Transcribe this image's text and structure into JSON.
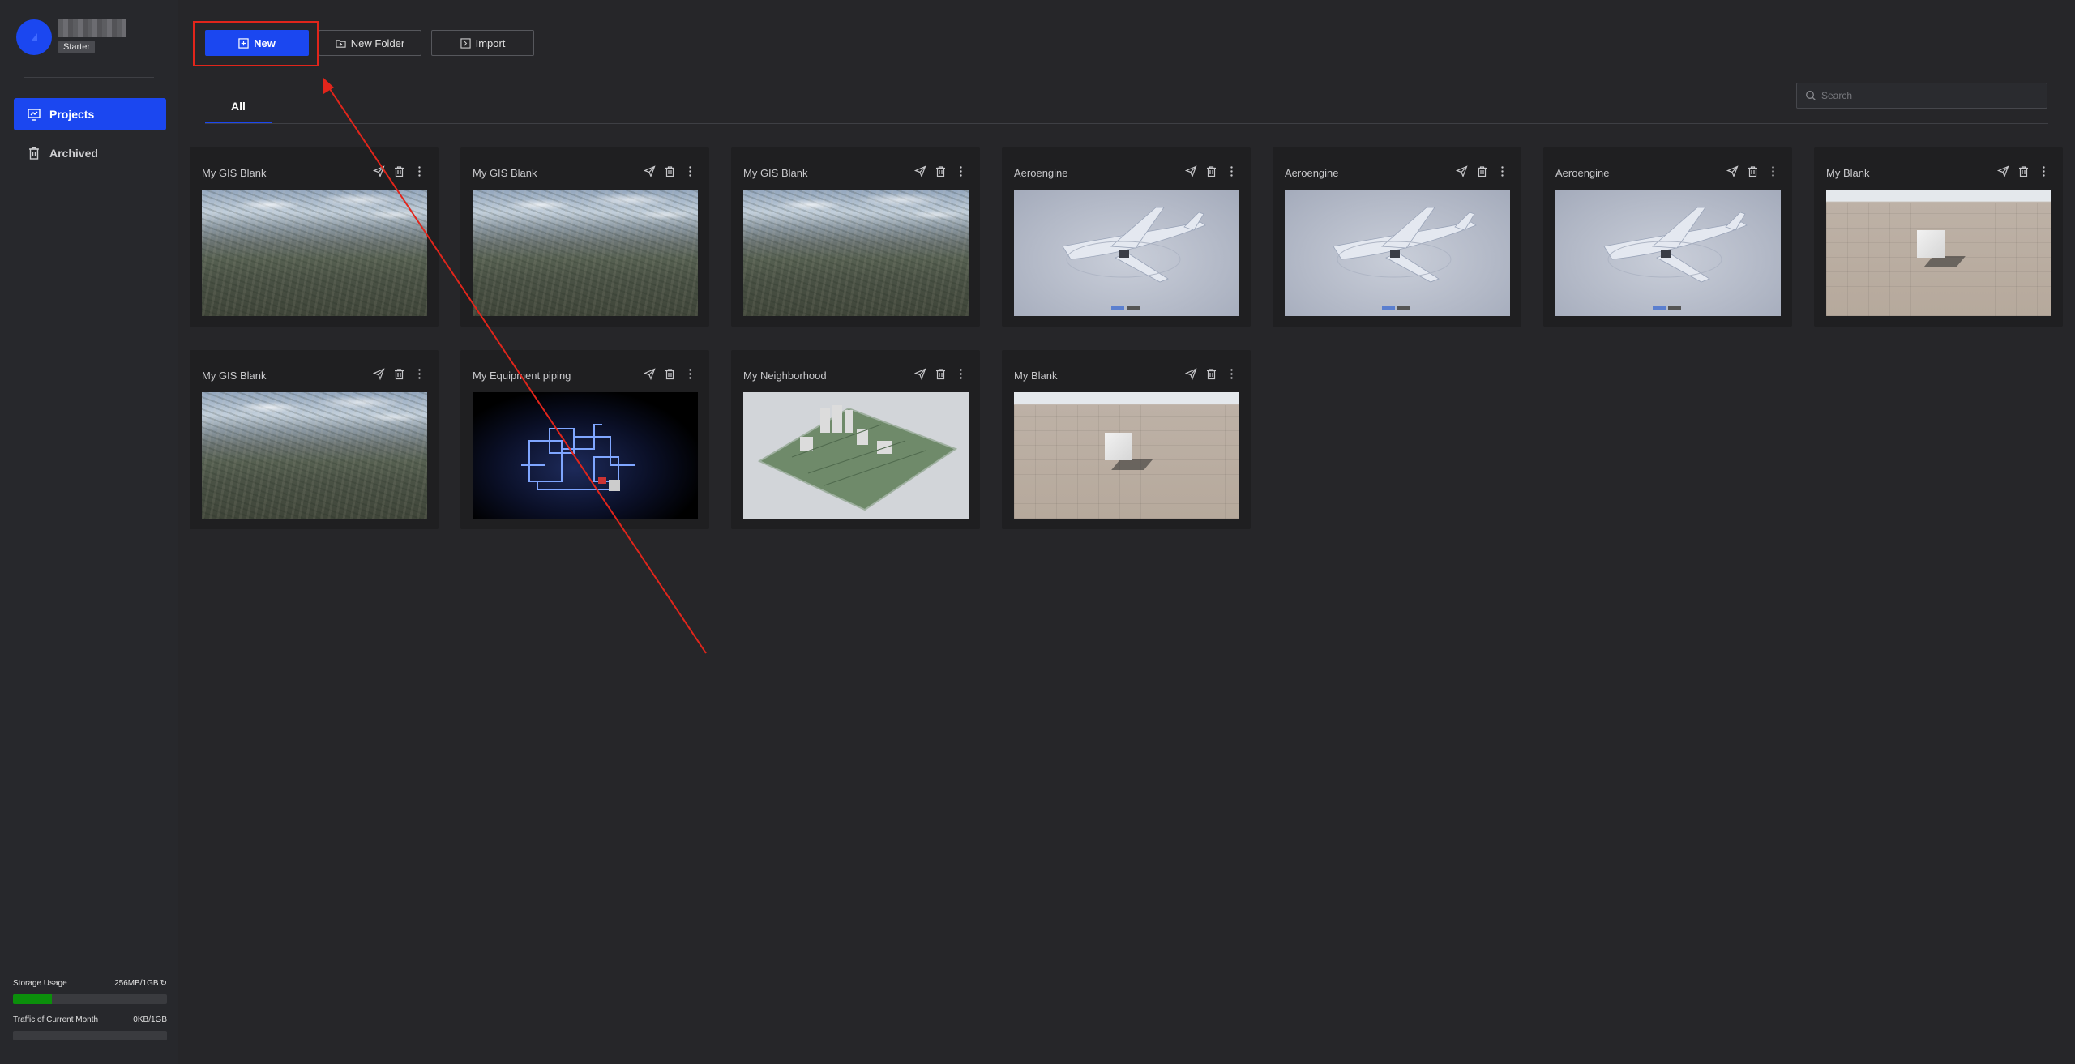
{
  "account": {
    "plan": "Starter"
  },
  "sidebar": {
    "items": [
      {
        "label": "Projects",
        "icon": "projects-icon",
        "active": true
      },
      {
        "label": "Archived",
        "icon": "trash-icon",
        "active": false
      }
    ]
  },
  "usage": {
    "storage_label": "Storage Usage",
    "storage_value": "256MB/1GB",
    "storage_fraction": 0.25,
    "traffic_label": "Traffic of Current Month",
    "traffic_value": "0KB/1GB",
    "traffic_fraction": 0
  },
  "toolbar": {
    "new_label": "New",
    "new_folder_label": "New Folder",
    "import_label": "Import"
  },
  "tabs": [
    {
      "label": "All",
      "active": true
    }
  ],
  "search": {
    "placeholder": "Search"
  },
  "projects": [
    {
      "title": "My GIS Blank",
      "thumb": "gis"
    },
    {
      "title": "My GIS Blank",
      "thumb": "gis"
    },
    {
      "title": "My GIS Blank",
      "thumb": "gis"
    },
    {
      "title": "Aeroengine",
      "thumb": "plane"
    },
    {
      "title": "Aeroengine",
      "thumb": "plane"
    },
    {
      "title": "Aeroengine",
      "thumb": "plane"
    },
    {
      "title": "My Blank",
      "thumb": "blank"
    },
    {
      "title": "My GIS Blank",
      "thumb": "gis"
    },
    {
      "title": "My Equipment piping",
      "thumb": "pipe"
    },
    {
      "title": "My Neighborhood",
      "thumb": "hood"
    },
    {
      "title": "My Blank",
      "thumb": "blank"
    }
  ],
  "colors": {
    "accent": "#1b47f0",
    "storage_fill": "#0b8f0b",
    "annotation": "#e1251b"
  }
}
